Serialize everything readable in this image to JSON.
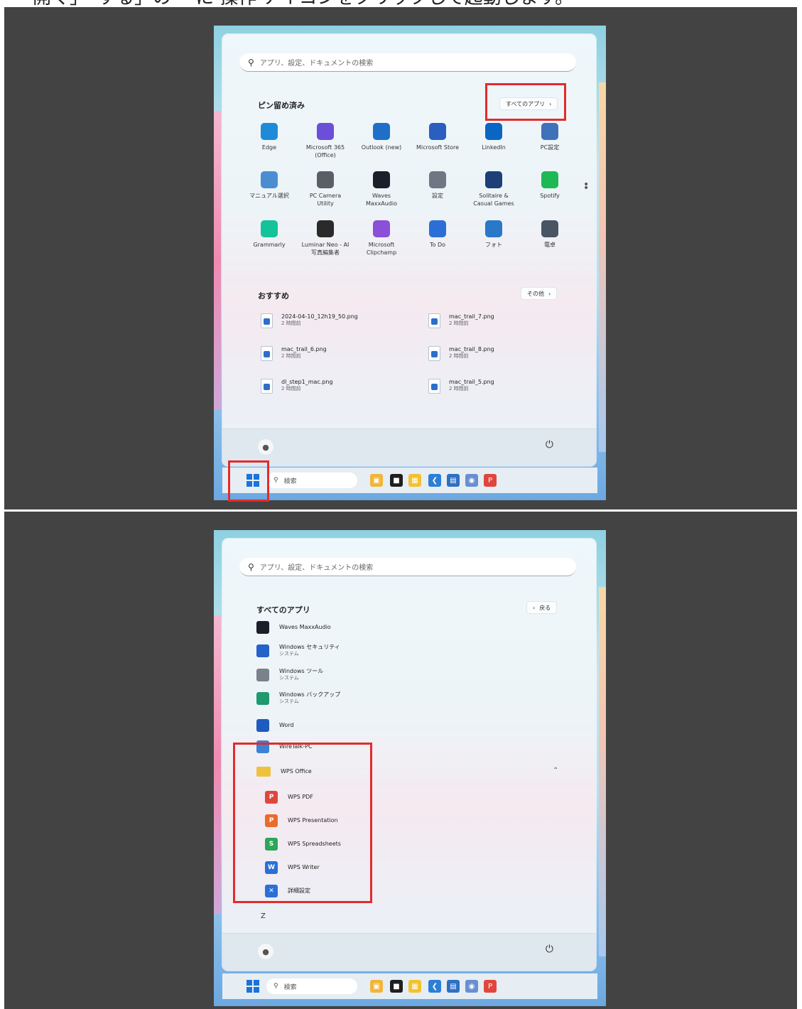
{
  "caption": "「開く」「する」の一 に 操作 アイコンをクリックして起動します。",
  "colors": {
    "accent": "#1a73d9",
    "highlight": "#e32b2b"
  },
  "panel1": {
    "search_placeholder": "アプリ、設定、ドキュメントの検索",
    "pinned_title": "ピン留め済み",
    "all_apps_button": "すべてのアプリ",
    "pinned_apps": [
      {
        "label": "Edge",
        "icon": "edge-icon",
        "color": "#1f8bd8"
      },
      {
        "label": "Microsoft 365\n(Office)",
        "icon": "microsoft365-icon",
        "color": "#6b4fd6"
      },
      {
        "label": "Outlook (new)",
        "icon": "outlook-icon",
        "color": "#1f6fc9"
      },
      {
        "label": "Microsoft Store",
        "icon": "store-icon",
        "color": "#2a5fbf"
      },
      {
        "label": "LinkedIn",
        "icon": "linkedin-icon",
        "color": "#0a66c2"
      },
      {
        "label": "PC設定",
        "icon": "pc-settings-icon",
        "color": "#3f72b8"
      },
      {
        "label": "マニュアル選択",
        "icon": "manual-icon",
        "color": "#4a8ed1"
      },
      {
        "label": "PC Camera\nUtility",
        "icon": "camera-icon",
        "color": "#5a5f67"
      },
      {
        "label": "Waves\nMaxxAudio",
        "icon": "waves-icon",
        "color": "#1b1f2a"
      },
      {
        "label": "設定",
        "icon": "gear-icon",
        "color": "#6f7782"
      },
      {
        "label": "Solitaire &\nCasual Games",
        "icon": "solitaire-icon",
        "color": "#1c3f77"
      },
      {
        "label": "Spotify",
        "icon": "spotify-icon",
        "color": "#1db954"
      },
      {
        "label": "Grammarly",
        "icon": "grammarly-icon",
        "color": "#15c39a"
      },
      {
        "label": "Luminar Neo - AI\n写真編集者",
        "icon": "luminar-icon",
        "color": "#2a2a2a"
      },
      {
        "label": "Microsoft\nClipchamp",
        "icon": "clipchamp-icon",
        "color": "#8b4fd8"
      },
      {
        "label": "To Do",
        "icon": "todo-icon",
        "color": "#2b6fd6"
      },
      {
        "label": "フォト",
        "icon": "photos-icon",
        "color": "#2a78c8"
      },
      {
        "label": "電卓",
        "icon": "calculator-icon",
        "color": "#4a5563"
      }
    ],
    "recommended_title": "おすすめ",
    "more_button": "その他",
    "recommended": [
      {
        "name": "2024-04-10_12h19_50.png",
        "time": "2 時間前"
      },
      {
        "name": "mac_trail_7.png",
        "time": "2 時間前"
      },
      {
        "name": "mac_trail_6.png",
        "time": "2 時間前"
      },
      {
        "name": "mac_trail_8.png",
        "time": "2 時間前"
      },
      {
        "name": "dl_step1_mac.png",
        "time": "2 時間前"
      },
      {
        "name": "mac_trail_5.png",
        "time": "2 時間前"
      }
    ],
    "taskbar_search": "検索"
  },
  "panel2": {
    "search_placeholder": "アプリ、設定、ドキュメントの検索",
    "title": "すべてのアプリ",
    "back_button": "戻る",
    "apps": [
      {
        "name": "Waves MaxxAudio",
        "sub": "",
        "icon": "waves-icon",
        "color": "#1b1f2a"
      },
      {
        "name": "Windows セキュリティ",
        "sub": "システム",
        "icon": "shield-icon",
        "color": "#2463c9"
      },
      {
        "name": "Windows ツール",
        "sub": "システム",
        "icon": "tools-icon",
        "color": "#7a828c"
      },
      {
        "name": "Windows バックアップ",
        "sub": "システム",
        "icon": "backup-icon",
        "color": "#1f9a6e"
      },
      {
        "name": "Word",
        "sub": "",
        "icon": "word-icon",
        "color": "#1f5bbf"
      },
      {
        "name": "WireTalk-PC",
        "sub": "",
        "icon": "wiretalk-icon",
        "color": "#3a84d8"
      }
    ],
    "folder": {
      "name": "WPS Office",
      "icon": "folder-icon",
      "color": "#f0c040"
    },
    "folder_items": [
      {
        "name": "WPS PDF",
        "icon": "wps-pdf-icon",
        "color": "#e0463c",
        "glyph": "P"
      },
      {
        "name": "WPS Presentation",
        "icon": "wps-presentation-icon",
        "color": "#ea6b2c",
        "glyph": "P"
      },
      {
        "name": "WPS Spreadsheets",
        "icon": "wps-spreadsheets-icon",
        "color": "#2ea55a",
        "glyph": "S"
      },
      {
        "name": "WPS Writer",
        "icon": "wps-writer-icon",
        "color": "#2c6fd6",
        "glyph": "W"
      },
      {
        "name": "詳細設定",
        "icon": "wps-settings-icon",
        "color": "#2c6fd6",
        "glyph": "✕"
      }
    ],
    "letter_z": "Z",
    "taskbar_search": "検索"
  }
}
